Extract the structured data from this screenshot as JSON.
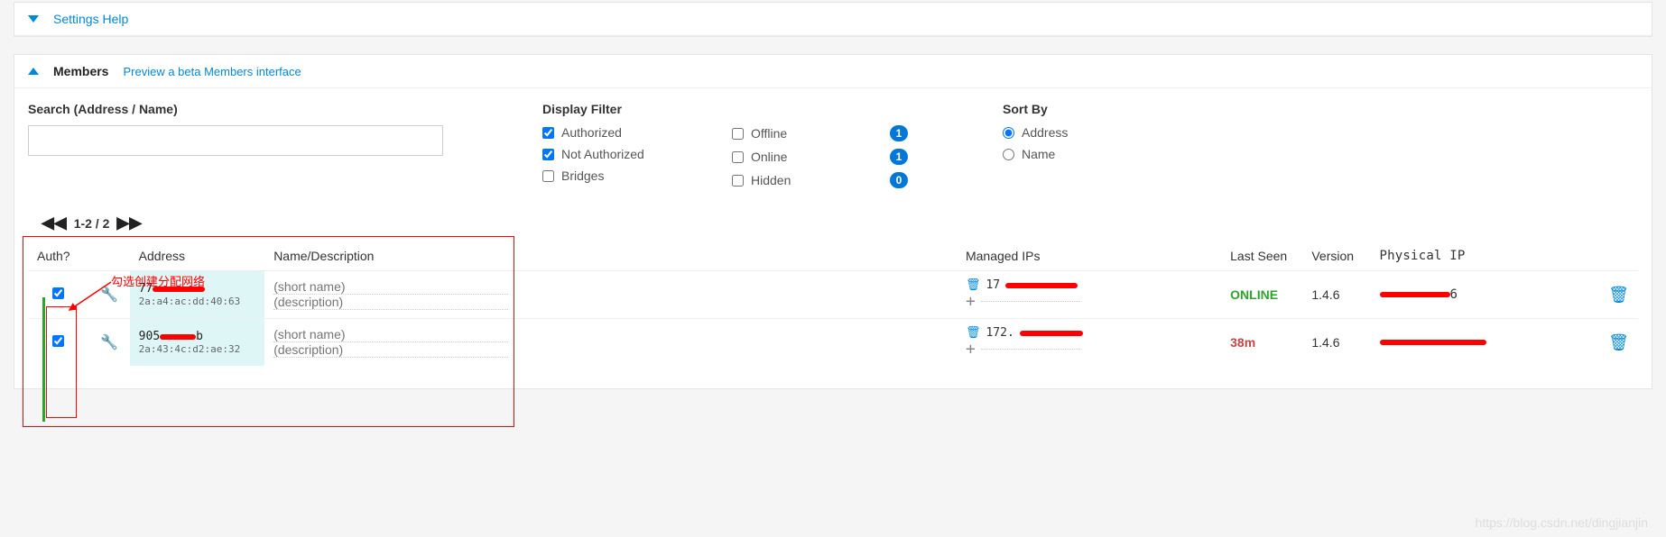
{
  "settings_help": {
    "title": "Settings Help"
  },
  "members_header": {
    "title": "Members",
    "preview_link": "Preview a beta Members interface"
  },
  "filters": {
    "search_label": "Search (Address / Name)",
    "search_value": "",
    "display_label": "Display Filter",
    "authorized": "Authorized",
    "not_authorized": "Not Authorized",
    "bridges": "Bridges",
    "offline": "Offline",
    "online": "Online",
    "hidden": "Hidden",
    "offline_count": "1",
    "online_count": "1",
    "hidden_count": "0",
    "sort_label": "Sort By",
    "sort_address": "Address",
    "sort_name": "Name"
  },
  "pager": {
    "range": "1-2 / 2"
  },
  "annotation": {
    "text": "勾选创建分配网络"
  },
  "table": {
    "headers": {
      "auth": "Auth?",
      "address": "Address",
      "name": "Name/Description",
      "mips": "Managed IPs",
      "lastseen": "Last Seen",
      "version": "Version",
      "pip": "Physical IP"
    },
    "rows": [
      {
        "auth_checked": true,
        "addr_line1_prefix": "77",
        "addr_line2": "2a:a4:ac:dd:40:63",
        "short_name_ph": "(short name)",
        "desc_ph": "(description)",
        "mip_prefix": "17",
        "lastseen": "ONLINE",
        "lastseen_class": "online",
        "version": "1.4.6",
        "pip_tail": "6"
      },
      {
        "auth_checked": true,
        "addr_line1_prefix": "905",
        "addr_line1_suffix": "b",
        "addr_line2": "2a:43:4c:d2:ae:32",
        "short_name_ph": "(short name)",
        "desc_ph": "(description)",
        "mip_prefix": "172.",
        "lastseen": "38m",
        "lastseen_class": "ago",
        "version": "1.4.6",
        "pip_tail": ""
      }
    ]
  },
  "watermark": "https://blog.csdn.net/dingjianjin"
}
